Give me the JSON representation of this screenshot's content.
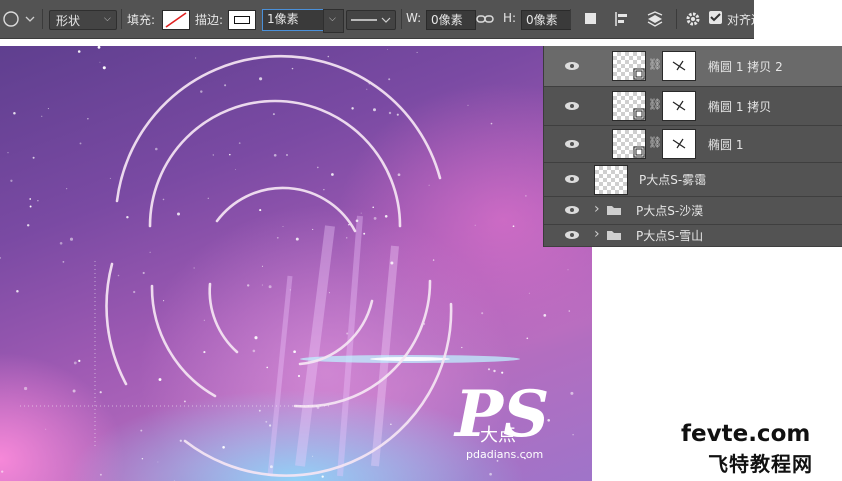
{
  "options_bar": {
    "mode": "形状",
    "fill_label": "填充:",
    "stroke_label": "描边:",
    "stroke_width": "1像素",
    "w_label": "W:",
    "w_value": "0像素",
    "h_label": "H:",
    "h_value": "0像素",
    "align_edges": "对齐边"
  },
  "layers": [
    {
      "name": "椭圆 1 拷贝 2",
      "selected": true,
      "type": "shape"
    },
    {
      "name": "椭圆 1 拷贝",
      "selected": false,
      "type": "shape"
    },
    {
      "name": "椭圆 1",
      "selected": false,
      "type": "shape"
    },
    {
      "name": "P大点S-雾霭",
      "selected": false,
      "type": "pixel"
    },
    {
      "name": "P大点S-沙漠",
      "selected": false,
      "type": "group"
    },
    {
      "name": "P大点S-雪山",
      "selected": false,
      "type": "group"
    }
  ],
  "canvas": {
    "logo_text": "PS",
    "logo_sub": "大点",
    "logo_url": "pdadians.com"
  },
  "watermark": {
    "site": "fevte.com",
    "chinese": "飞特教程网"
  },
  "colors": {
    "panel_bg": "#535353",
    "selected_row": "#6a6a6a",
    "field_focus": "#4a90d9"
  }
}
